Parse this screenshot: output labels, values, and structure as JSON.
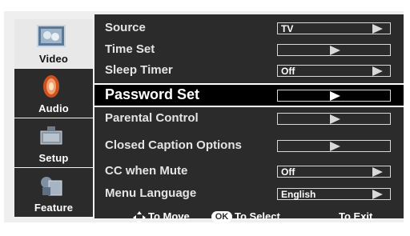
{
  "sidebar": {
    "tabs": [
      {
        "label": "Video",
        "icon": "video-icon",
        "active": true
      },
      {
        "label": "Audio",
        "icon": "audio-speaker-icon",
        "active": false
      },
      {
        "label": "Setup",
        "icon": "setup-icon",
        "active": false
      },
      {
        "label": "Feature",
        "icon": "feature-icon",
        "active": false
      }
    ]
  },
  "menu": {
    "items": [
      {
        "label": "Source",
        "value": "TV",
        "arrow": "right"
      },
      {
        "label": "Time Set",
        "value": "",
        "arrow": "mid"
      },
      {
        "label": "Sleep Timer",
        "value": "Off",
        "arrow": "right"
      },
      {
        "label": "Password Set",
        "value": "",
        "arrow": "mid",
        "selected": true
      },
      {
        "label": "Parental Control",
        "value": "",
        "arrow": "mid"
      },
      {
        "label": "Closed Caption Options",
        "value": "",
        "arrow": "mid"
      },
      {
        "label": "CC when Mute",
        "value": "Off",
        "arrow": "right"
      },
      {
        "label": "Menu Language",
        "value": "English",
        "arrow": "right"
      }
    ]
  },
  "help": {
    "move": "To Move",
    "ok_key": "OK",
    "select": "To Select",
    "exit": "To Exit"
  },
  "colors": {
    "panel": "#2b2b2b",
    "selected_row": "#000000",
    "frame": "#efefef",
    "text": "#e4e4e4"
  }
}
